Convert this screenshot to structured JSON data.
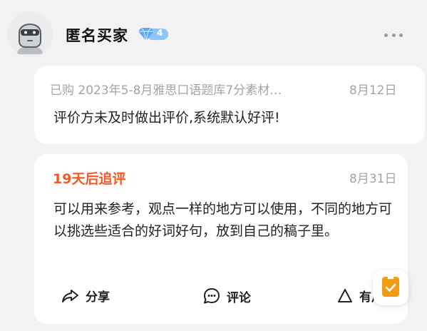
{
  "user": {
    "name": "匿名买家",
    "level": "4"
  },
  "first_review": {
    "purchase_info": "已购  2023年5-8月雅思口语题库7分素材…",
    "date": "8月12日",
    "text": "评价方未及时做出评价,系统默认好评!"
  },
  "follow_up": {
    "title": "19天后追评",
    "date": "8月31日",
    "text": "可以用来参考，观点一样的地方可以使用，不同的地方可以挑选些适合的好词好句，放到自己的稿子里。"
  },
  "actions": {
    "share": "分享",
    "comment": "评论",
    "useful": "有用"
  },
  "colors": {
    "accent": "#f15a24",
    "vip": "#5aa9f5",
    "float": "#f39c12"
  },
  "icons": [
    "avatar-robot",
    "diamond-icon",
    "more-icon",
    "share-icon",
    "comment-icon",
    "thumb-icon",
    "note-icon"
  ]
}
